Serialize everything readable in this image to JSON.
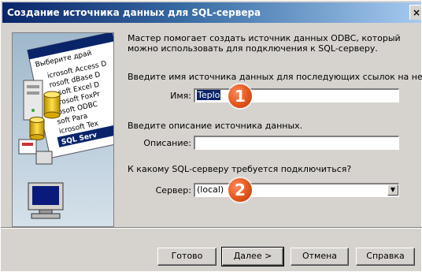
{
  "window": {
    "title": "Создание источника данных для SQL-сервера",
    "close_glyph": "×"
  },
  "illustration": {
    "card_text_top": "Выберите драй",
    "drivers": [
      "icrosoft Access D",
      "rosoft dBase D",
      "rosoft Excel D",
      "icrosoft FoxPr",
      "rosoft ODBC",
      "soft Para",
      "icrosoft Tex",
      "SQL Serv"
    ],
    "icon": "server-database-illustration"
  },
  "content": {
    "intro": "Мастер помогает создать источник данных ODBC, который можно использовать для подключения к SQL-серверу.",
    "name_prompt": "Введите имя источника данных для последующих ссылок на него.",
    "name_label": "Имя:",
    "name_value": "Teplo",
    "desc_prompt": "Введите описание источника данных.",
    "desc_label": "Описание:",
    "desc_value": "",
    "server_prompt": "К какому SQL-серверу требуется подключиться?",
    "server_label": "Сервер:",
    "server_value": "(local)"
  },
  "badges": {
    "one": "1",
    "two": "2"
  },
  "buttons": {
    "finish": "Готово",
    "next": "Далее >",
    "cancel": "Отмена",
    "help": "Справка"
  },
  "colors": {
    "title_start": "#0a246a",
    "dialog_bg": "#d6d3ce",
    "badge": "#e2561c"
  }
}
